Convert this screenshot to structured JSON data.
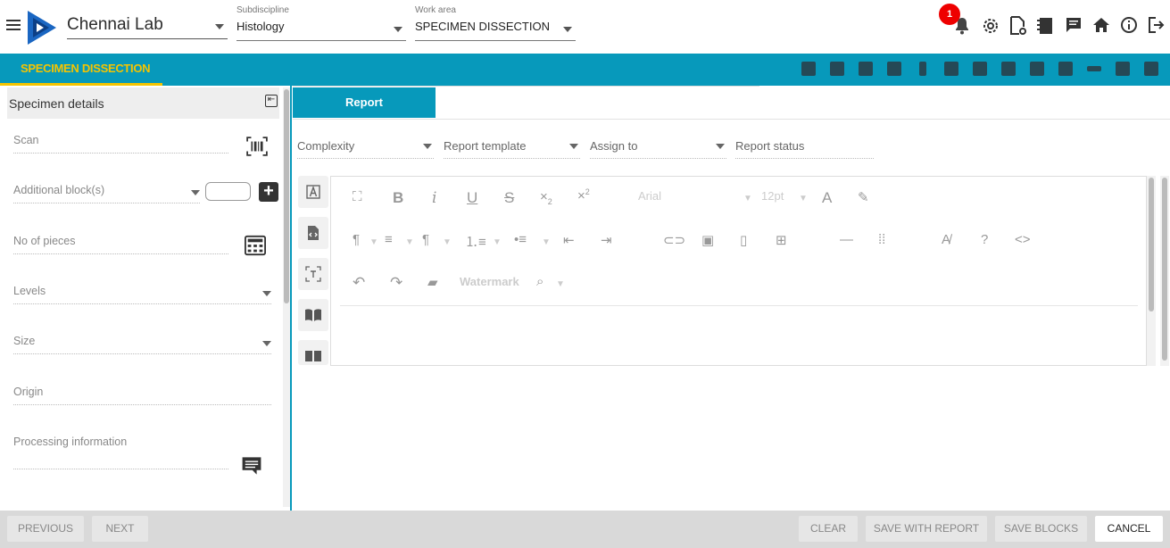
{
  "header": {
    "lab": "Chennai Lab",
    "subdiscipline_label": "Subdiscipline",
    "subdiscipline_value": "Histology",
    "workarea_label": "Work area",
    "workarea_value": "SPECIMEN DISSECTION",
    "notification_count": "1",
    "icons": [
      "bell-icon",
      "settings-icon",
      "document-settings-icon",
      "notebook-icon",
      "chat-icon",
      "home-icon",
      "info-icon",
      "logout-icon"
    ]
  },
  "toolbar": {
    "title": "SPECIMEN DISSECTION",
    "accent_color": "#0799bb",
    "title_color": "#f5c400"
  },
  "left_panel": {
    "title": "Specimen details",
    "scan": "Scan",
    "additional_blocks": "Additional block(s)",
    "no_of_pieces": "No of pieces",
    "levels": "Levels",
    "size": "Size",
    "origin": "Origin",
    "processing_information": "Processing information"
  },
  "report": {
    "tab": "Report",
    "complexity": "Complexity",
    "report_template": "Report template",
    "assign_to": "Assign to",
    "report_status": "Report status",
    "font": "Arial",
    "font_size": "12pt",
    "watermark": "Watermark"
  },
  "footer": {
    "previous": "PREVIOUS",
    "next": "NEXT",
    "clear": "CLEAR",
    "save_with_report": "SAVE WITH REPORT",
    "save_blocks": "SAVE BLOCKS",
    "cancel": "CANCEL"
  }
}
